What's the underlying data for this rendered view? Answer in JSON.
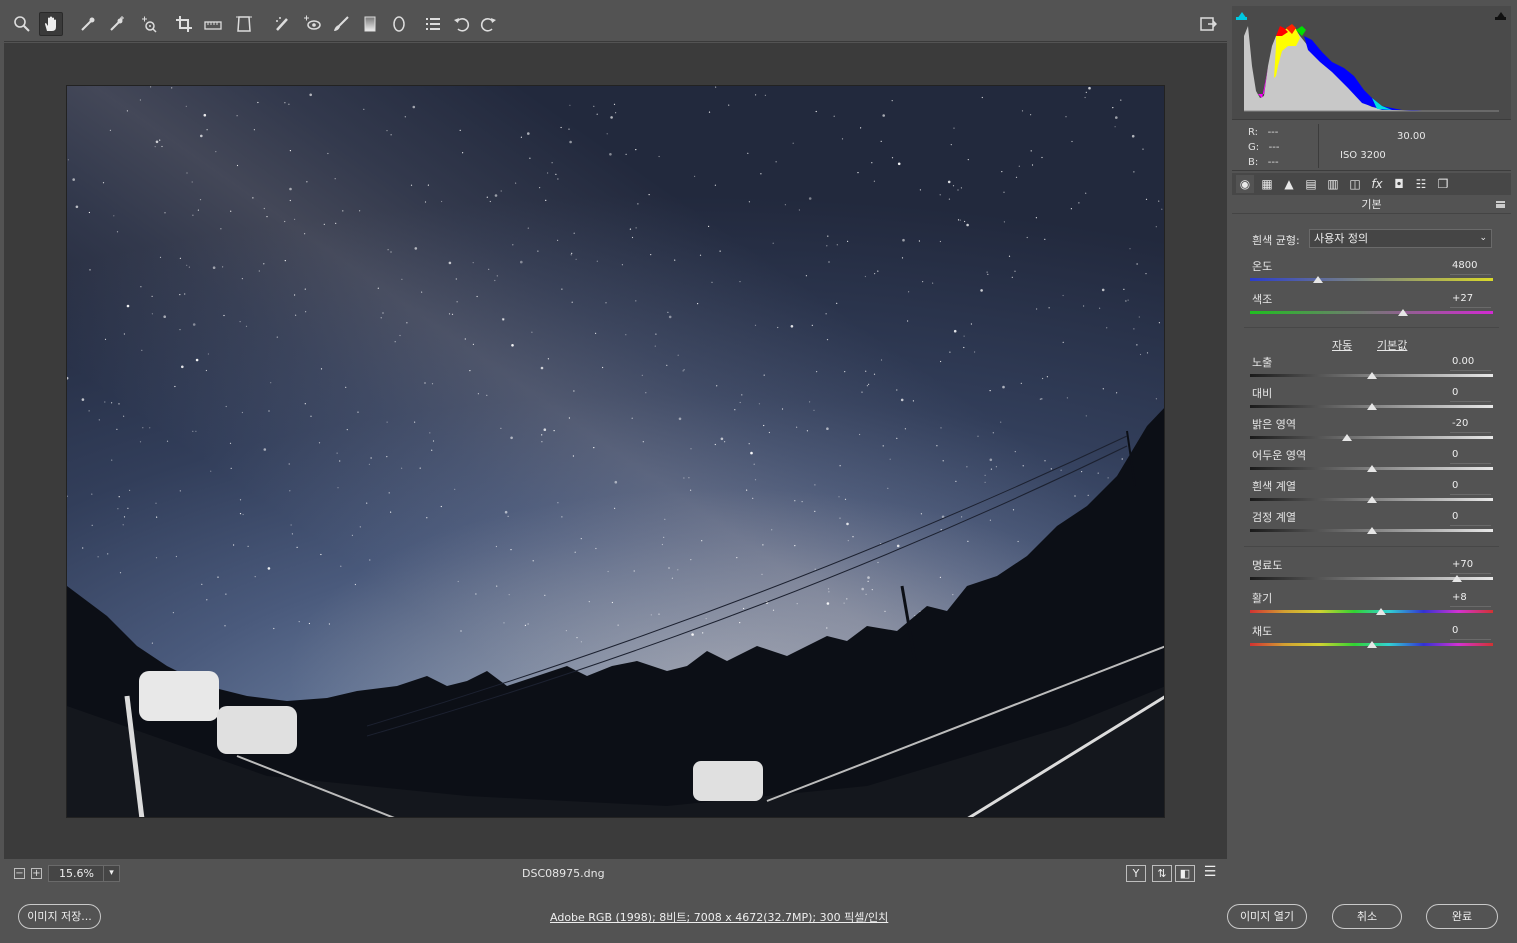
{
  "toolbar": {
    "tools": [
      "zoom-icon",
      "hand-icon",
      "white-balance-icon",
      "color-sampler-icon",
      "target-adjust-icon",
      "crop-icon",
      "straighten-icon",
      "transform-icon",
      "spot-removal-icon",
      "red-eye-icon",
      "adjustment-brush-icon",
      "graduated-filter-icon",
      "radial-filter-icon",
      "preferences-icon",
      "rotate-left-icon",
      "rotate-right-icon"
    ],
    "fullscreen_icon": "fullscreen-icon"
  },
  "status": {
    "zoom": "15.6%",
    "filename": "DSC08975.dng",
    "zoom_out": "−",
    "zoom_in": "+",
    "icons": [
      "Y",
      "⇅",
      "◧",
      "☰"
    ]
  },
  "info": {
    "r_label": "R:",
    "r_value": "---",
    "g_label": "G:",
    "g_value": "---",
    "b_label": "B:",
    "b_value": "---",
    "shutter": "30.00",
    "iso": "ISO 3200"
  },
  "panel": {
    "section_title": "기본",
    "wb_label": "흰색 균형:",
    "wb_value": "사용자 정의",
    "auto_link": "자동",
    "default_link": "기본값",
    "sliders": [
      {
        "label": "온도",
        "value": "4800",
        "pos": 0.28,
        "track": "temp"
      },
      {
        "label": "색조",
        "value": "+27",
        "pos": 0.63,
        "track": "tint"
      },
      {
        "label": "노출",
        "value": "0.00",
        "pos": 0.5,
        "track": "gray"
      },
      {
        "label": "대비",
        "value": "0",
        "pos": 0.5,
        "track": "gray"
      },
      {
        "label": "밝은 영역",
        "value": "-20",
        "pos": 0.4,
        "track": "gray"
      },
      {
        "label": "어두운 영역",
        "value": "0",
        "pos": 0.5,
        "track": "gray"
      },
      {
        "label": "흰색 계열",
        "value": "0",
        "pos": 0.5,
        "track": "gray"
      },
      {
        "label": "검정 계열",
        "value": "0",
        "pos": 0.5,
        "track": "gray"
      },
      {
        "label": "명료도",
        "value": "+70",
        "pos": 0.85,
        "track": "gray"
      },
      {
        "label": "활기",
        "value": "+8",
        "pos": 0.54,
        "track": "hue"
      },
      {
        "label": "채도",
        "value": "0",
        "pos": 0.5,
        "track": "hue"
      }
    ]
  },
  "bottom": {
    "save_button": "이미지 저장...",
    "workflow_link": "Adobe RGB (1998); 8비트; 7008 x 4672(32.7MP); 300 픽셀/인치",
    "open_button": "이미지 열기",
    "cancel_button": "취소",
    "done_button": "완료"
  }
}
